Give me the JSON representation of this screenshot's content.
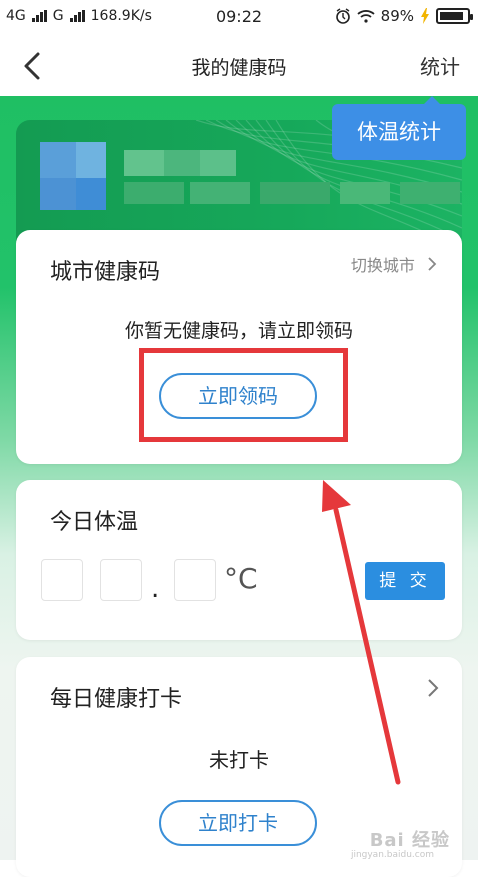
{
  "status_bar": {
    "network1": "4G",
    "network2": "G",
    "speed": "168.9K/s",
    "time": "09:22",
    "battery": "89%",
    "battery_level": 0.89
  },
  "navbar": {
    "title": "我的健康码",
    "right_label": "统计"
  },
  "tooltip": {
    "label": "体温统计"
  },
  "city_code_card": {
    "title": "城市健康码",
    "switch_city": "切换城市",
    "message": "你暂无健康码，请立即领码",
    "button": "立即领码"
  },
  "temperature_card": {
    "title": "今日体温",
    "dot": ".",
    "unit": "°C",
    "submit": "提 交"
  },
  "checkin_card": {
    "title": "每日健康打卡",
    "status": "未打卡",
    "button": "立即打卡"
  },
  "watermark": {
    "text": "Bai 经验",
    "sub": "jingyan.baidu.com"
  },
  "colors": {
    "green": "#1fbf63",
    "blue": "#3d8fe6",
    "annotation_red": "#e5383b"
  }
}
